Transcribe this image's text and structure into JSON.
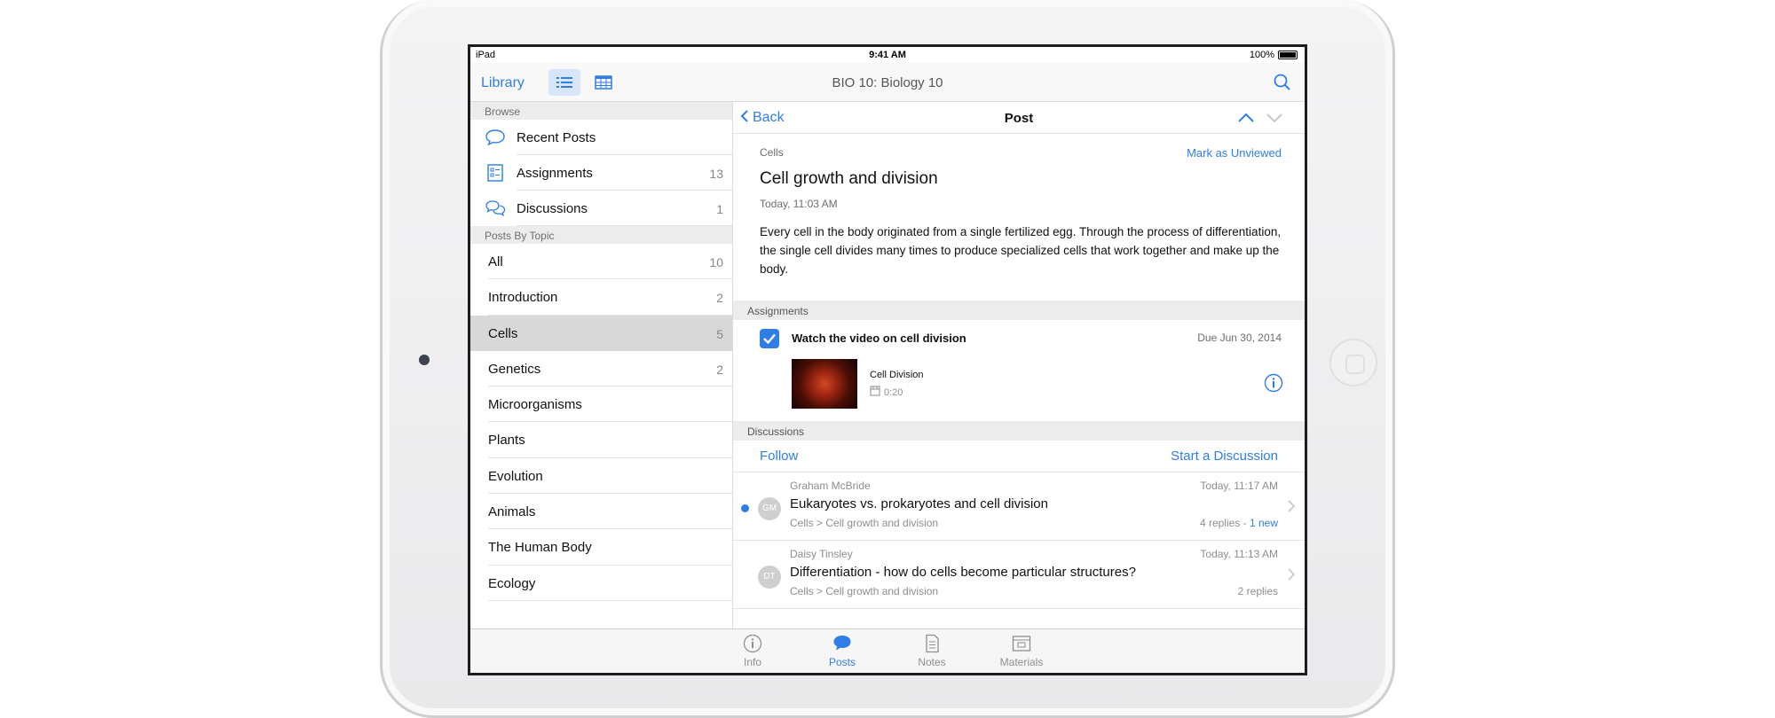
{
  "status_bar": {
    "carrier": "iPad",
    "time": "9:41 AM",
    "battery": "100%"
  },
  "navbar": {
    "library_label": "Library",
    "title": "BIO 10: Biology 10"
  },
  "sidebar": {
    "browse_header": "Browse",
    "browse_items": [
      {
        "label": "Recent Posts",
        "count": "",
        "icon": "speech-bubble-icon"
      },
      {
        "label": "Assignments",
        "count": "13",
        "icon": "checklist-icon"
      },
      {
        "label": "Discussions",
        "count": "1",
        "icon": "discussion-bubbles-icon"
      }
    ],
    "topics_header": "Posts By Topic",
    "topics": [
      {
        "label": "All",
        "count": "10"
      },
      {
        "label": "Introduction",
        "count": "2"
      },
      {
        "label": "Cells",
        "count": "5"
      },
      {
        "label": "Genetics",
        "count": "2"
      },
      {
        "label": "Microorganisms",
        "count": ""
      },
      {
        "label": "Plants",
        "count": ""
      },
      {
        "label": "Evolution",
        "count": ""
      },
      {
        "label": "Animals",
        "count": ""
      },
      {
        "label": "The Human Body",
        "count": ""
      },
      {
        "label": "Ecology",
        "count": ""
      }
    ],
    "selected_topic": "Cells"
  },
  "detail": {
    "back_label": "Back",
    "title": "Post",
    "post": {
      "topic": "Cells",
      "mark_unviewed": "Mark as Unviewed",
      "title": "Cell growth and division",
      "date": "Today, 11:03 AM",
      "body": "Every cell in the body originated from a single fertilized egg. Through the process of differentiation, the single cell divides many times to produce specialized cells that work together and make up the body."
    },
    "assignments": {
      "header": "Assignments",
      "item_title": "Watch the video on cell division",
      "due": "Due Jun 30, 2014",
      "video_title": "Cell Division",
      "video_length": "0:20",
      "checked": true
    },
    "discussions": {
      "header": "Discussions",
      "follow_label": "Follow",
      "start_label": "Start a Discussion",
      "items": [
        {
          "author": "Graham McBride",
          "initials": "GM",
          "title": "Eukaryotes vs. prokaryotes and cell division",
          "path": "Cells > Cell growth and division",
          "time": "Today, 11:17 AM",
          "replies": "4 replies",
          "new": "1 new",
          "unread": true
        },
        {
          "author": "Daisy Tinsley",
          "initials": "DT",
          "title": "Differentiation - how do cells become particular structures?",
          "path": "Cells > Cell growth and division",
          "time": "Today, 11:13 AM",
          "replies": "2 replies",
          "new": "",
          "unread": false
        }
      ]
    }
  },
  "tabbar": {
    "tabs": [
      {
        "label": "Info",
        "icon": "info-icon"
      },
      {
        "label": "Posts",
        "icon": "posts-bubble-icon"
      },
      {
        "label": "Notes",
        "icon": "notes-icon"
      },
      {
        "label": "Materials",
        "icon": "materials-icon"
      }
    ],
    "active": "Posts"
  },
  "colors": {
    "accent": "#2f7ee8",
    "selected_row": "#d8d8d8",
    "section_band": "#ececed"
  }
}
